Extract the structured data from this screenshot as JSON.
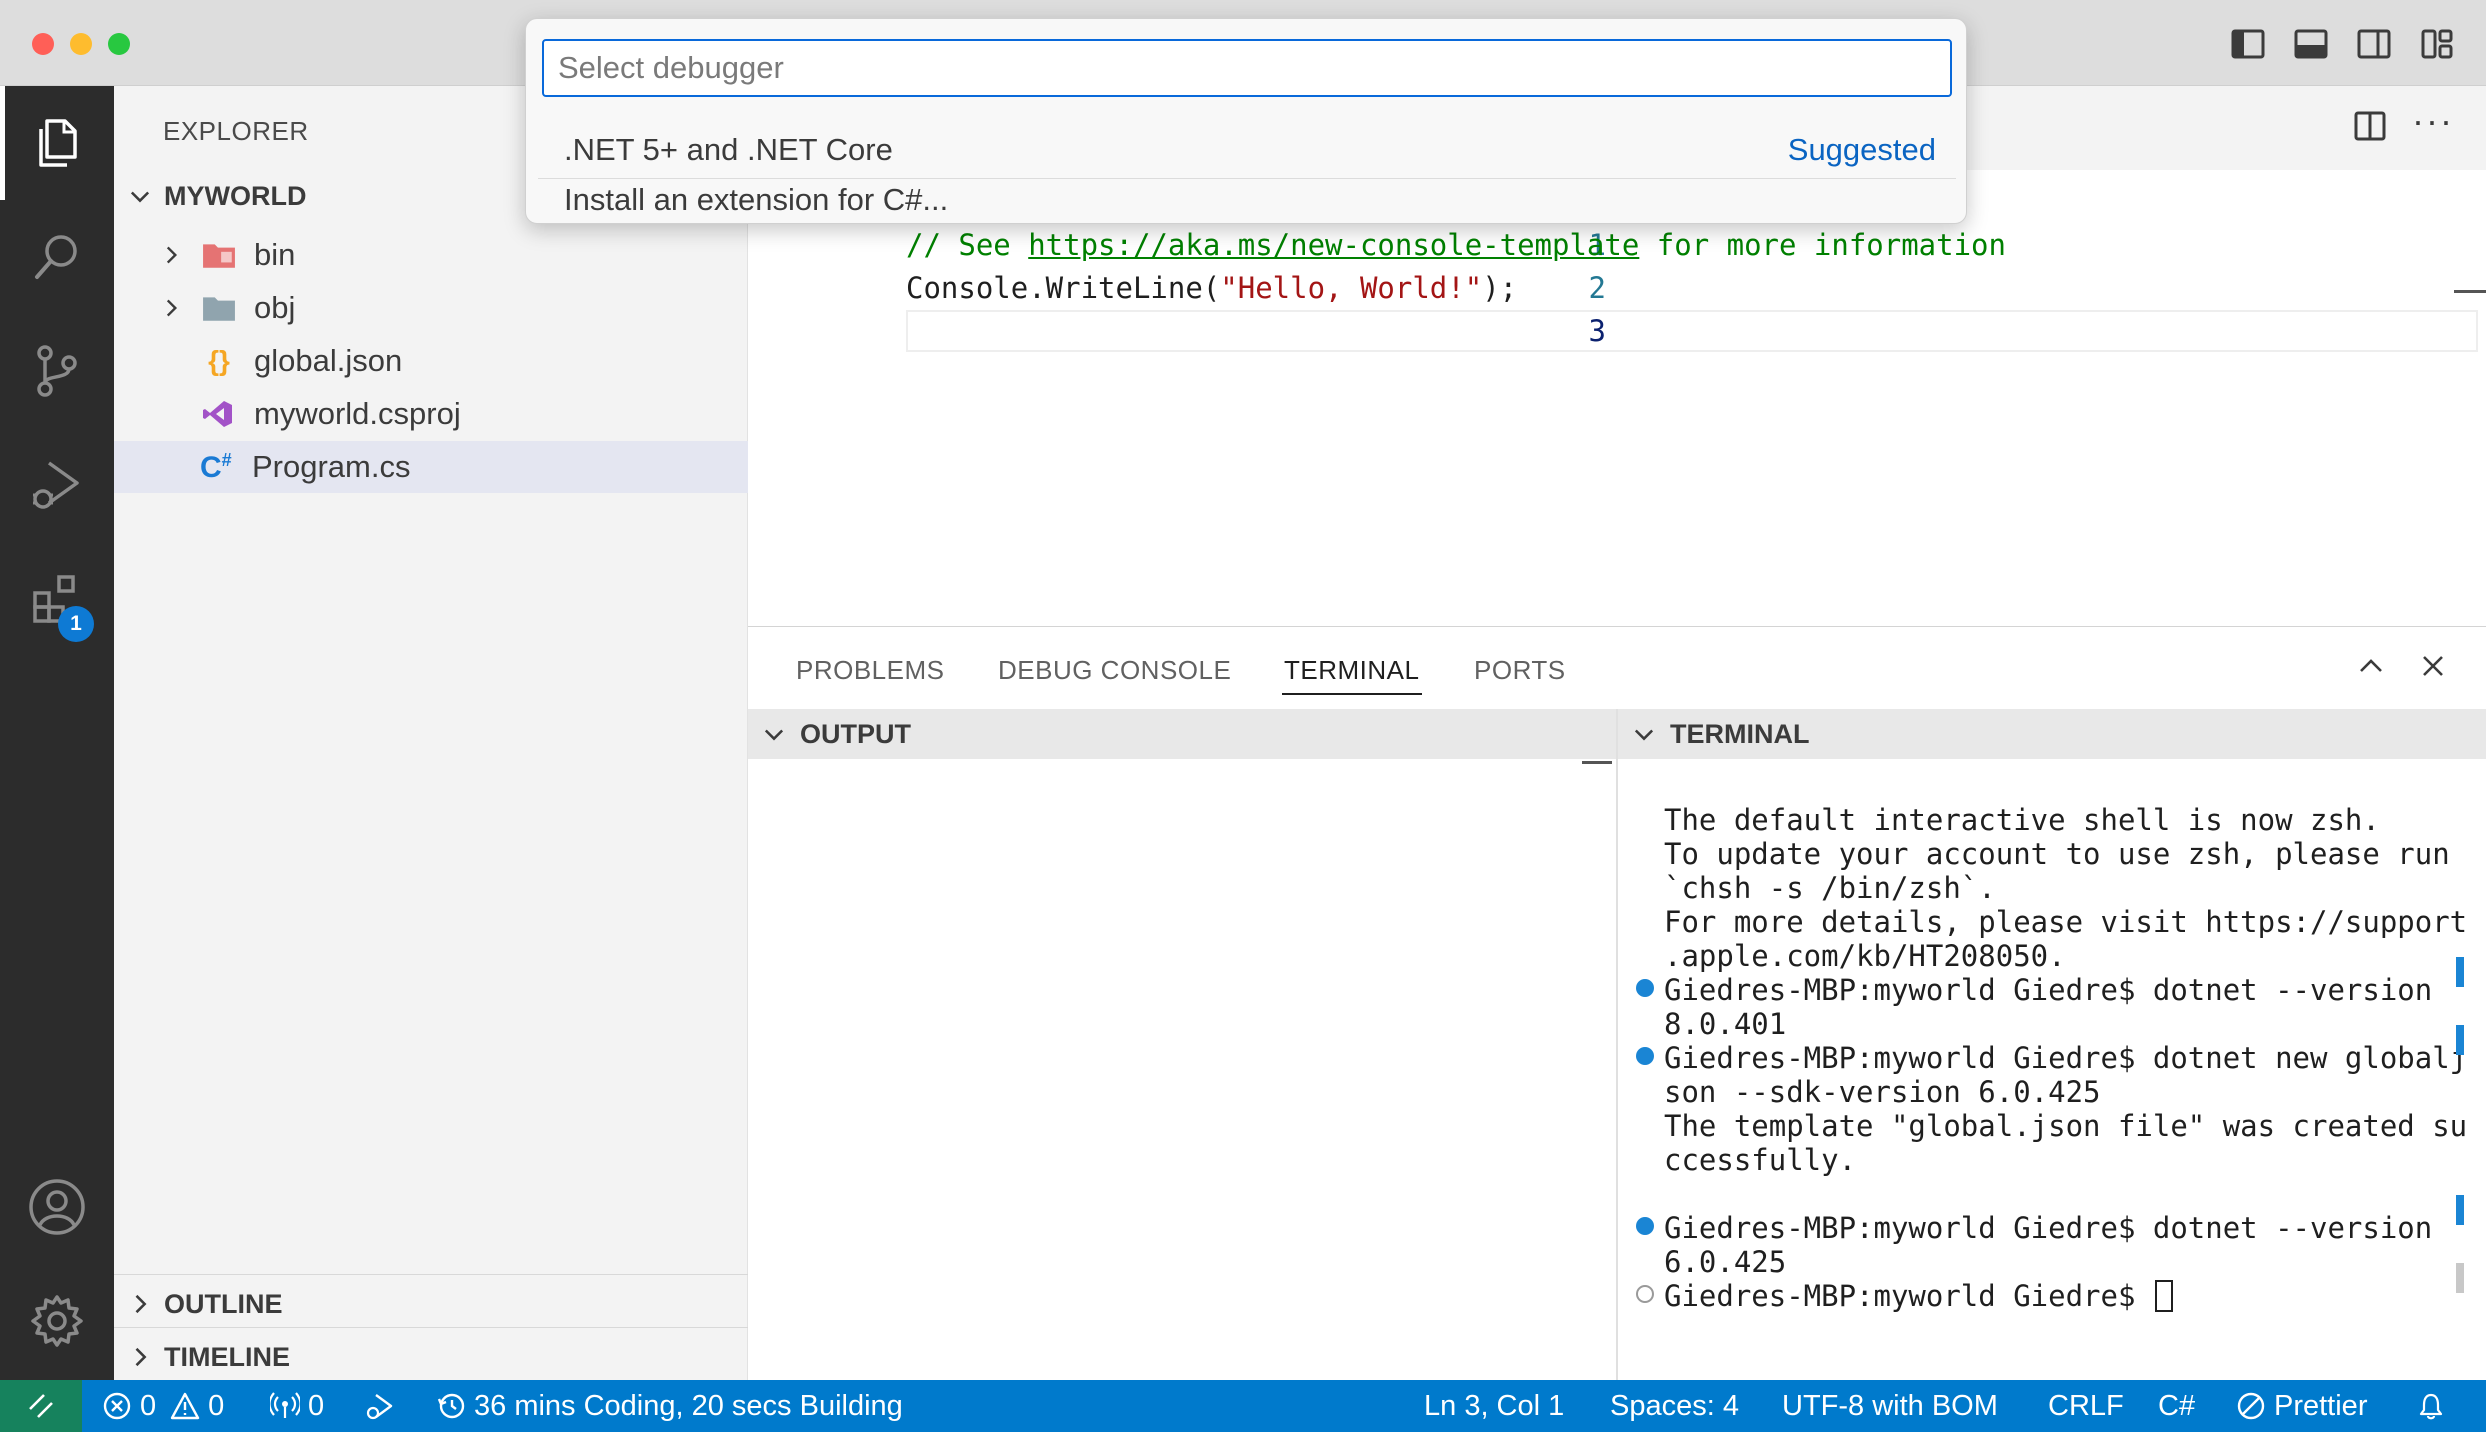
{
  "quick_pick": {
    "placeholder": "Select debugger",
    "items": [
      {
        "label": ".NET 5+ and .NET Core",
        "tag": "Suggested"
      },
      {
        "label": "Install an extension for C#..."
      }
    ]
  },
  "sidebar": {
    "title": "EXPLORER",
    "folder": "MYWORLD",
    "files": [
      {
        "name": "bin",
        "kind": "folder"
      },
      {
        "name": "obj",
        "kind": "folder"
      },
      {
        "name": "global.json",
        "kind": "json"
      },
      {
        "name": "myworld.csproj",
        "kind": "csproj"
      },
      {
        "name": "Program.cs",
        "kind": "csharp"
      }
    ],
    "outline": "OUTLINE",
    "timeline": "TIMELINE"
  },
  "activity": {
    "extensions_badge": "1"
  },
  "editor": {
    "line_numbers": [
      "1",
      "2",
      "3"
    ],
    "line1_comment_start": "// See ",
    "line1_link": "https://aka.ms/new-console-template",
    "line1_comment_end": " for more information",
    "line2_code": "Console.WriteLine(",
    "line2_string": "\"Hello, World!\"",
    "line2_end": ");"
  },
  "panel": {
    "tabs": [
      "PROBLEMS",
      "DEBUG CONSOLE",
      "TERMINAL",
      "PORTS"
    ],
    "output_title": "OUTPUT",
    "terminal_title": "TERMINAL",
    "terminal_lines": [
      "The default interactive shell is now zsh.",
      "To update your account to use zsh, please run",
      "`chsh -s /bin/zsh`.",
      "For more details, please visit https://support",
      ".apple.com/kb/HT208050.",
      "Giedres-MBP:myworld Giedre$ dotnet --version",
      "8.0.401",
      "Giedres-MBP:myworld Giedre$ dotnet new globalj",
      "son --sdk-version 6.0.425",
      "The template \"global.json file\" was created su",
      "ccessfully.",
      "Giedres-MBP:myworld Giedre$ dotnet --version",
      "6.0.425",
      "Giedres-MBP:myworld Giedre$ "
    ]
  },
  "statusbar": {
    "errors": "0",
    "warnings": "0",
    "ports": "0",
    "coding_time": "36 mins Coding, 20 secs Building",
    "position": "Ln 3, Col 1",
    "spaces": "Spaces: 4",
    "encoding": "UTF-8 with BOM",
    "eol": "CRLF",
    "language": "C#",
    "prettier": "Prettier"
  },
  "colors": {
    "accent": "#007acc",
    "activity_bar": "#2c2c2c",
    "sidebar": "#f3f3f3",
    "selection": "#e4e6f1",
    "comment": "#008000",
    "string": "#a31515",
    "terminal_dot": "#1a85d4"
  }
}
